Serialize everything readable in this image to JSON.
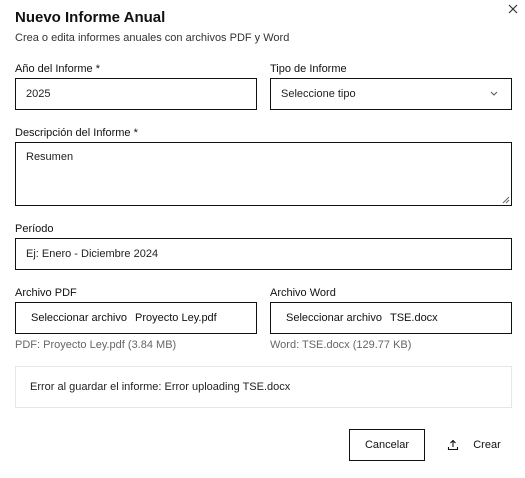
{
  "dialog": {
    "title": "Nuevo Informe Anual",
    "subtitle": "Crea o edita informes anuales con archivos PDF y Word",
    "close_icon": "close-icon"
  },
  "form": {
    "year_label": "Año del Informe *",
    "year_value": "2025",
    "type_label": "Tipo de Informe",
    "type_selected": "Seleccione tipo",
    "description_label": "Descripción del Informe *",
    "description_value": "Resumen",
    "period_label": "Período",
    "period_placeholder": "Ej: Enero - Diciembre 2024",
    "pdf_label": "Archivo PDF",
    "pdf_button": "Seleccionar archivo",
    "pdf_filename": "Proyecto Ley.pdf",
    "pdf_info": "PDF: Proyecto Ley.pdf (3.84 MB)",
    "word_label": "Archivo Word",
    "word_button": "Seleccionar archivo",
    "word_filename": "TSE.docx",
    "word_info": "Word: TSE.docx (129.77 KB)"
  },
  "error": {
    "message": "Error al guardar el informe: Error uploading TSE.docx"
  },
  "actions": {
    "cancel_label": "Cancelar",
    "create_label": "Crear",
    "create_icon": "upload-icon"
  },
  "colors": {
    "border": "#111111",
    "muted_text": "#666666",
    "error_border": "#e6e6e6"
  }
}
